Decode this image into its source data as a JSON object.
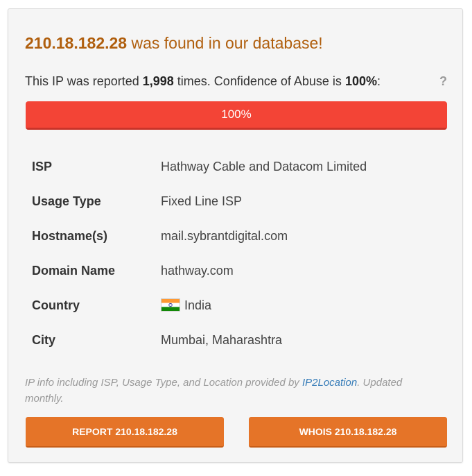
{
  "headline": {
    "ip": "210.18.182.28",
    "suffix": " was found in our database!"
  },
  "report": {
    "prefix": "This IP was reported ",
    "count": "1,998",
    "middle": " times. Confidence of Abuse is ",
    "confidence": "100%",
    "suffix": ":",
    "help_glyph": "?"
  },
  "progress": {
    "value_percent": 100,
    "label": "100%",
    "color": "#f34436"
  },
  "details": [
    {
      "key": "ISP",
      "value": "Hathway Cable and Datacom Limited"
    },
    {
      "key": "Usage Type",
      "value": "Fixed Line ISP"
    },
    {
      "key": "Hostname(s)",
      "value": "mail.sybrantdigital.com"
    },
    {
      "key": "Domain Name",
      "value": "hathway.com"
    },
    {
      "key": "Country",
      "value": "India",
      "icon": "india-flag-icon"
    },
    {
      "key": "City",
      "value": "Mumbai, Maharashtra"
    }
  ],
  "note": {
    "prefix": "IP info including ISP, Usage Type, and Location provided by ",
    "link": "IP2Location",
    "suffix": ". Updated monthly."
  },
  "buttons": {
    "report": "REPORT 210.18.182.28",
    "whois": "WHOIS 210.18.182.28"
  },
  "colors": {
    "accent": "#e57428",
    "headline": "#b05f0e",
    "danger": "#f34436",
    "link": "#337ab7"
  }
}
